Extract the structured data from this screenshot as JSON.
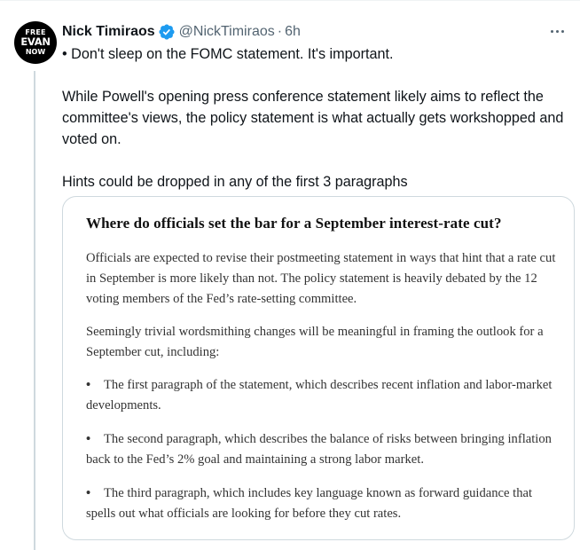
{
  "author": {
    "name": "Nick Timiraos",
    "handle": "@NickTimiraos",
    "separator": "·",
    "time": "6h",
    "avatar_lines": [
      "FREE",
      "EVAN",
      "NOW"
    ]
  },
  "tweet": {
    "paragraphs": [
      "• Don't sleep on the FOMC statement. It's important.",
      "While Powell's opening press conference statement likely aims to reflect the committee's views, the policy statement is what actually gets workshopped and voted on.",
      "Hints could be dropped in any of the first 3 paragraphs"
    ]
  },
  "card": {
    "title": "Where do officials set the bar for a September interest-rate cut?",
    "paragraphs": [
      "Officials are expected to revise their postmeeting statement in ways that hint that a rate cut in September is more likely than not. The policy statement is heavily debated by the 12 voting members of the Fed’s rate-setting committee.",
      "Seemingly trivial wordsmithing changes will be meaningful in framing the outlook for a September cut, including:"
    ],
    "bullets": [
      "The first paragraph of the statement, which describes recent inflation and labor-market developments.",
      "The second paragraph, which describes the balance of risks between bringing inflation back to the Fed’s 2% goal and maintaining a strong labor market.",
      "The third paragraph, which includes key language known as forward guidance that spells out what officials are looking for before they cut rates."
    ],
    "bullet_symbol": "•"
  },
  "colors": {
    "verified": "#1d9bf0",
    "secondary_text": "#536471",
    "border": "#cfd9de"
  }
}
